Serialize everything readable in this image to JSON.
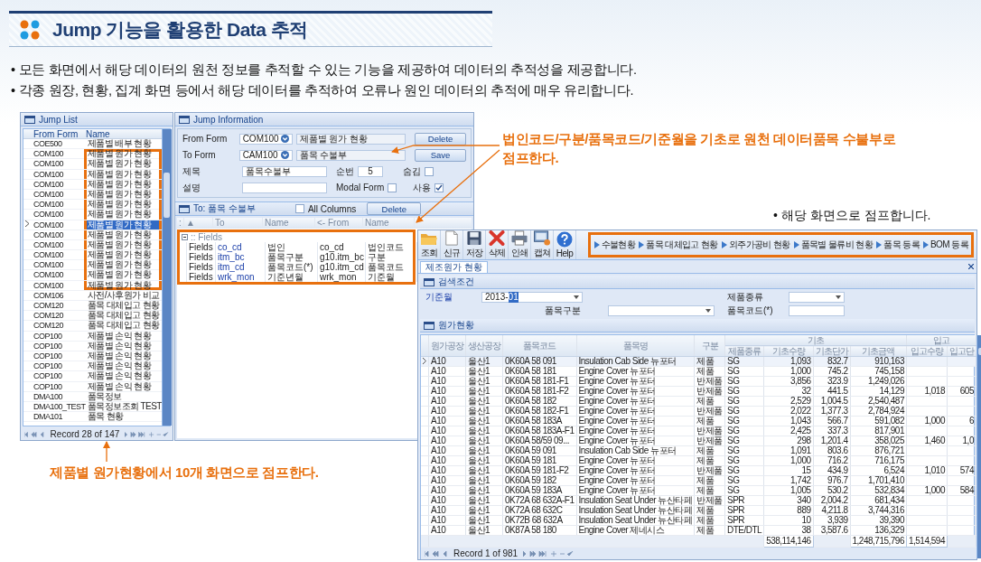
{
  "slide": {
    "title": "Jump 기능을 활용한 Data 추적",
    "bullets": [
      "• 모든 화면에서 해당 데이터의 원천 정보를 추적할 수 있는 기능을 제공하여 데이터의 추적성을 제공합니다.",
      "• 각종 원장, 현황, 집계 화면 등에서 해당 데이터를 추적하여 오류나 원인 데이터의 추적에 매우 유리합니다."
    ]
  },
  "jump_list": {
    "title": "Jump List",
    "columns": [
      "From Form",
      "Name"
    ],
    "rows": [
      {
        "from_form": "COE500",
        "name": "제품별 배부 현황",
        "selected": false,
        "highlighted": false
      },
      {
        "from_form": "COM100",
        "name": "제품별 원가 현황",
        "selected": false,
        "highlighted": true
      },
      {
        "from_form": "COM100",
        "name": "제품별 원가 현황",
        "selected": false,
        "highlighted": true
      },
      {
        "from_form": "COM100",
        "name": "제품별 원가 현황",
        "selected": false,
        "highlighted": true
      },
      {
        "from_form": "COM100",
        "name": "제품별 원가 현황",
        "selected": false,
        "highlighted": true
      },
      {
        "from_form": "COM100",
        "name": "제품별 원가 현황",
        "selected": false,
        "highlighted": true
      },
      {
        "from_form": "COM100",
        "name": "제품별 원가 현황",
        "selected": false,
        "highlighted": true
      },
      {
        "from_form": "COM100",
        "name": "제품별 원가 현황",
        "selected": false,
        "highlighted": true
      },
      {
        "from_form": "COM100",
        "name": "제품별 원가 현황",
        "selected": true,
        "highlighted": true
      },
      {
        "from_form": "COM100",
        "name": "제품별 원가 현황",
        "selected": false,
        "highlighted": true
      },
      {
        "from_form": "COM100",
        "name": "제품별 원가 현황",
        "selected": false,
        "highlighted": true
      },
      {
        "from_form": "COM100",
        "name": "제품별 원가 현황",
        "selected": false,
        "highlighted": true
      },
      {
        "from_form": "COM100",
        "name": "제품별 원가 현황",
        "selected": false,
        "highlighted": true
      },
      {
        "from_form": "COM100",
        "name": "제품별 원가 현황",
        "selected": false,
        "highlighted": true
      },
      {
        "from_form": "COM100",
        "name": "제품별 원가 현황",
        "selected": false,
        "highlighted": true
      },
      {
        "from_form": "COM106",
        "name": "사전/사후원가 비교",
        "selected": false,
        "highlighted": false
      },
      {
        "from_form": "COM120",
        "name": "품목 대체입고 현황",
        "selected": false,
        "highlighted": false
      },
      {
        "from_form": "COM120",
        "name": "품목 대체입고 현황",
        "selected": false,
        "highlighted": false
      },
      {
        "from_form": "COM120",
        "name": "품목 대체입고 현황",
        "selected": false,
        "highlighted": false
      },
      {
        "from_form": "COP100",
        "name": "제품별 손익 현황",
        "selected": false,
        "highlighted": false
      },
      {
        "from_form": "COP100",
        "name": "제품별 손익 현황",
        "selected": false,
        "highlighted": false
      },
      {
        "from_form": "COP100",
        "name": "제품별 손익 현황",
        "selected": false,
        "highlighted": false
      },
      {
        "from_form": "COP100",
        "name": "제품별 손익 현황",
        "selected": false,
        "highlighted": false
      },
      {
        "from_form": "COP100",
        "name": "제품별 손익 현황",
        "selected": false,
        "highlighted": false
      },
      {
        "from_form": "COP100",
        "name": "제품별 손익 현황",
        "selected": false,
        "highlighted": false
      },
      {
        "from_form": "DMA100",
        "name": "품목정보",
        "selected": false,
        "highlighted": false
      },
      {
        "from_form": "DMA100_TEST",
        "name": "품목정보조회 TEST",
        "selected": false,
        "highlighted": false
      },
      {
        "from_form": "DMA101",
        "name": "품목 현황",
        "selected": false,
        "highlighted": false
      }
    ],
    "record": "Record 28 of 147"
  },
  "jump_information": {
    "title": "Jump Information",
    "from_form": {
      "label": "From Form",
      "code": "COM100",
      "name": "제품별 원가 현황"
    },
    "to_form": {
      "label": "To Form",
      "code": "CAM100",
      "name": "품목 수불부"
    },
    "subject": {
      "label": "제목",
      "value": "품목수불부"
    },
    "order": {
      "label": "순번",
      "value": "5"
    },
    "hidden": {
      "label": "숨김",
      "checked": false
    },
    "description": {
      "label": "설명"
    },
    "modal_form": {
      "label": "Modal Form",
      "checked": false
    },
    "use": {
      "label": "사용",
      "checked": true
    },
    "buttons": [
      "Delete",
      "Save"
    ]
  },
  "mapping": {
    "title": "To: 품목 수불부",
    "all_columns": {
      "label": "All Columns",
      "checked": false
    },
    "delete_button": "Delete",
    "row_header": ":",
    "columns": [
      "▲",
      "To",
      "Name",
      "<- From",
      "Name"
    ],
    "group": ":: Fields",
    "rows": [
      [
        "Fields",
        "co_cd",
        "법인",
        "co_cd",
        "법인코드"
      ],
      [
        "Fields",
        "itm_bc",
        "품목구분",
        "g10.itm_bc",
        "구분"
      ],
      [
        "Fields",
        "itm_cd",
        "품목코드(*)",
        "g10.itm_cd",
        "품목코드"
      ],
      [
        "Fields",
        "wrk_mon",
        "기준년월",
        "wrk_mon",
        "기준월"
      ]
    ]
  },
  "main_window": {
    "toolbar": [
      {
        "label": "조회",
        "kind": "folder"
      },
      {
        "label": "신규",
        "kind": "page"
      },
      {
        "label": "저장",
        "kind": "disk"
      },
      {
        "label": "삭제",
        "kind": "delete"
      },
      {
        "label": "인쇄",
        "kind": "printer"
      },
      {
        "label": "캡쳐",
        "kind": "capture"
      },
      {
        "label": "Help",
        "kind": "help"
      }
    ],
    "jump_links": [
      "수불현황",
      "품목 대체입고 현황",
      "외주가공비 현황",
      "품목별 물류비 현황",
      "품목 등록",
      "BOM 등록"
    ],
    "tabs": [
      {
        "label": "제조원가 현황",
        "selected": true
      }
    ],
    "search": {
      "title": "검색조건",
      "fields": [
        {
          "label": "기준월",
          "value": "2013-",
          "selection": "01",
          "kind": "dropdown",
          "required": true
        },
        {
          "label": "제품종류",
          "kind": "dropdown",
          "required": false
        },
        {
          "label": "품목구분",
          "kind": "dropdown",
          "required": false
        },
        {
          "label": "품목코드(*)",
          "kind": "text",
          "required": false
        }
      ]
    },
    "grid": {
      "title": "원가현황",
      "columns": [
        "원가공장",
        "생산공장",
        "품목코드",
        "품목명",
        "구분"
      ],
      "column_groups": [
        {
          "label": "기초",
          "columns": [
            "제품종류",
            "기초수량",
            "기초단가",
            "기초금액"
          ]
        },
        {
          "label": "입고",
          "columns": [
            "입고수량",
            "입고단"
          ]
        }
      ],
      "rows": [
        {
          "selected": true,
          "cells": [
            "A10",
            "울산1",
            "0K60A 58 091",
            "Insulation Cab Side 뉴포터",
            "제품",
            "SG",
            "1,093",
            "832.7",
            "910,163"
          ]
        },
        {
          "selected": false,
          "cells": [
            "A10",
            "울산1",
            "0K60A 58 181",
            "Engine Cover 뉴포터",
            "제품",
            "SG",
            "1,000",
            "745.2",
            "745,158"
          ]
        },
        {
          "selected": false,
          "cells": [
            "A10",
            "울산1",
            "0K60A 58 181-F1",
            "Engine Cover 뉴포터",
            "반제품",
            "SG",
            "3,856",
            "323.9",
            "1,249,026"
          ]
        },
        {
          "selected": false,
          "cells": [
            "A10",
            "울산1",
            "0K60A 58 181-F2",
            "Engine Cover 뉴포터",
            "반제품",
            "SG",
            "32",
            "441.5",
            "14,129",
            "1,018",
            "605"
          ]
        },
        {
          "selected": false,
          "cells": [
            "A10",
            "울산1",
            "0K60A 58 182",
            "Engine Cover 뉴포터",
            "제품",
            "SG",
            "2,529",
            "1,004.5",
            "2,540,487"
          ]
        },
        {
          "selected": false,
          "cells": [
            "A10",
            "울산1",
            "0K60A 58 182-F1",
            "Engine Cover 뉴포터",
            "반제품",
            "SG",
            "2,022",
            "1,377.3",
            "2,784,924"
          ]
        },
        {
          "selected": false,
          "cells": [
            "A10",
            "울산1",
            "0K60A 58 183A",
            "Engine Cover 뉴포터",
            "제품",
            "SG",
            "1,043",
            "566.7",
            "591,082",
            "1,000",
            "6"
          ]
        },
        {
          "selected": false,
          "cells": [
            "A10",
            "울산1",
            "0K60A 58 183A-F1",
            "Engine Cover 뉴포터",
            "반제품",
            "SG",
            "2,425",
            "337.3",
            "817,901"
          ]
        },
        {
          "selected": false,
          "cells": [
            "A10",
            "울산1",
            "0K60A 58/59 09...",
            "Engine Cover 뉴포터",
            "반제품",
            "SG",
            "298",
            "1,201.4",
            "358,025",
            "1,460",
            "1,0"
          ]
        },
        {
          "selected": false,
          "cells": [
            "A10",
            "울산1",
            "0K60A 59 091",
            "Insulation Cab Side 뉴포터",
            "제품",
            "SG",
            "1,091",
            "803.6",
            "876,721"
          ]
        },
        {
          "selected": false,
          "cells": [
            "A10",
            "울산1",
            "0K60A 59 181",
            "Engine Cover 뉴포터",
            "제품",
            "SG",
            "1,000",
            "716.2",
            "716,175"
          ]
        },
        {
          "selected": false,
          "cells": [
            "A10",
            "울산1",
            "0K60A 59 181-F2",
            "Engine Cover 뉴포터",
            "반제품",
            "SG",
            "15",
            "434.9",
            "6,524",
            "1,010",
            "574"
          ]
        },
        {
          "selected": false,
          "cells": [
            "A10",
            "울산1",
            "0K60A 59 182",
            "Engine Cover 뉴포터",
            "제품",
            "SG",
            "1,742",
            "976.7",
            "1,701,410"
          ]
        },
        {
          "selected": false,
          "cells": [
            "A10",
            "울산1",
            "0K60A 59 183A",
            "Engine Cover 뉴포터",
            "제품",
            "SG",
            "1,005",
            "530.2",
            "532,834",
            "1,000",
            "584"
          ]
        },
        {
          "selected": false,
          "cells": [
            "A10",
            "울산1",
            "0K72A 68 632A-F1",
            "Insulation Seat Under 뉴산타페",
            "반제품",
            "SPR",
            "340",
            "2,004.2",
            "681,434"
          ]
        },
        {
          "selected": false,
          "cells": [
            "A10",
            "울산1",
            "0K72A 68 632C",
            "Insulation Seat Under 뉴산타페",
            "제품",
            "SPR",
            "889",
            "4,211.8",
            "3,744,316"
          ]
        },
        {
          "selected": false,
          "cells": [
            "A10",
            "울산1",
            "0K72B 68 632A",
            "Insulation Seat Under 뉴산타페",
            "제품",
            "SPR",
            "10",
            "3,939",
            "39,390"
          ]
        },
        {
          "selected": false,
          "cells": [
            "A10",
            "울산1",
            "0K87A 58 180",
            "Engine Cover 제네시스",
            "제품",
            "DTE/DTL",
            "38",
            "3,587.6",
            "136,329"
          ]
        }
      ],
      "totals": {
        "base_qty": "538,114,146",
        "base_amount": "1,248,715,796",
        "in_qty": "1,514,594"
      },
      "record": "Record 1 of 981"
    }
  },
  "callouts": [
    "법인코드/구분/품목코드/기준월을 기초로 원천 데이터품목 수불부로 점프한다.",
    "제품별 원가현황에서 10개 화면으로 점프한다."
  ],
  "note": "• 해당 화면으로 점프합니다."
}
